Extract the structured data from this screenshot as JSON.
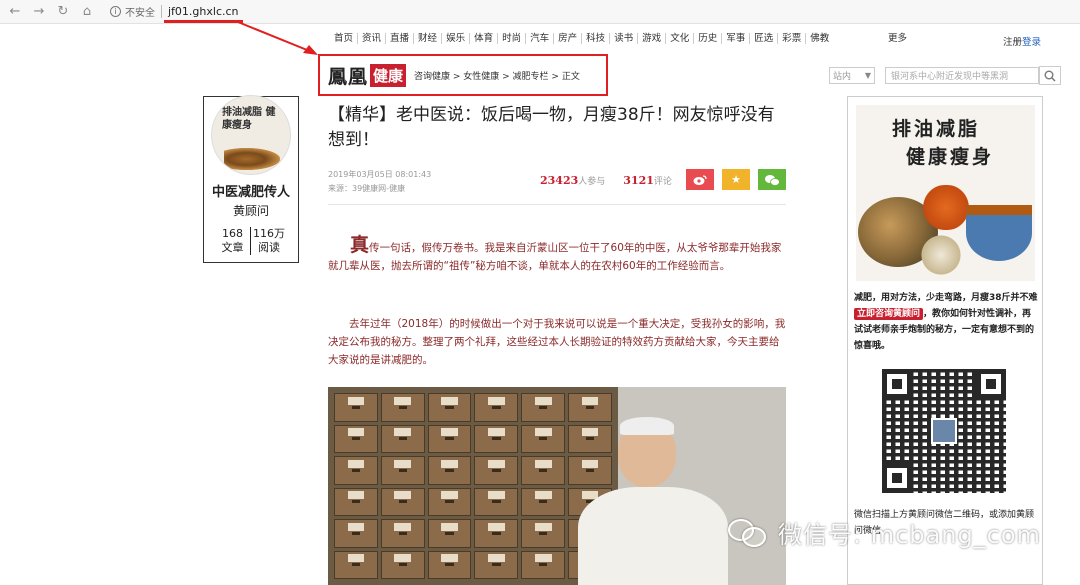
{
  "browser": {
    "security_label": "不安全",
    "url": "jf01.ghxlc.cn"
  },
  "topnav": {
    "items": [
      "首页",
      "资讯",
      "直播",
      "财经",
      "娱乐",
      "体育",
      "时尚",
      "汽车",
      "房产",
      "科技",
      "读书",
      "游戏",
      "文化",
      "历史",
      "军事",
      "匠选",
      "彩票",
      "佛教"
    ],
    "more": "更多",
    "login": "注册",
    "register": "登录"
  },
  "brand": {
    "logo_text": "鳳凰",
    "logo_tag": "健康",
    "breadcrumb": "咨询健康 > 女性健康 > 减肥专栏 > 正文"
  },
  "search": {
    "scope": "站内",
    "placeholder": "银河系中心附近发现中等黑洞"
  },
  "author": {
    "avatar_calligraphy": "排油减脂 健康瘦身",
    "title": "中医减肥传人",
    "name": "黄顾问",
    "articles_count": "168",
    "articles_label": "文章",
    "reads_count": "116万",
    "reads_label": "阅读"
  },
  "article": {
    "title": "【精华】老中医说：饭后喝一物，月瘦38斤！网友惊呼没有想到！",
    "date": "2019年03月05日 08:01:43",
    "source": "来源：39健康网-健康",
    "participants": "23423",
    "participants_label": "人参与",
    "comments": "3121",
    "comments_label": "评论",
    "dropcap": "真",
    "para1": "传一句话，假传万卷书。我是来自沂蒙山区一位干了60年的中医，从太爷爷那辈开始我家就几辈从医，抛去所谓的“祖传”秘方咱不谈，单就本人的在农村60年的工作经验而言。",
    "para2": "去年过年（2018年）的时候做出一个对于我来说可以说是一个重大决定，受我孙女的影响，我决定公布我的秘方。整理了两个礼拜，这些经过本人长期验证的特效药方贡献给大家，今天主要给大家说的是讲减肥的。"
  },
  "share": {
    "weibo_icon": "weibo-icon",
    "star_icon": "star-icon",
    "wechat_icon": "wechat-icon"
  },
  "ad": {
    "calligraphy_line1": "排油减脂",
    "calligraphy_line2": "健康瘦身",
    "text_before": "减肥，用对方法，少走弯路，月瘦38斤并不难",
    "cta": "立即咨询黄顾问",
    "text_after": "，教你如何针对性调补，再试试老师亲手炮制的秘方，一定有意想不到的惊喜哦。",
    "footer": "微信扫描上方黄顾问微信二维码，或添加黄顾问微信"
  },
  "watermark": {
    "text": "微信号: mcbang_com"
  },
  "colors": {
    "accent_red": "#c8202f",
    "highlight_red": "#e02020",
    "body_text": "#8b2a2a",
    "weibo": "#e84b50",
    "star": "#f0b32a",
    "wechat": "#63b83b"
  }
}
